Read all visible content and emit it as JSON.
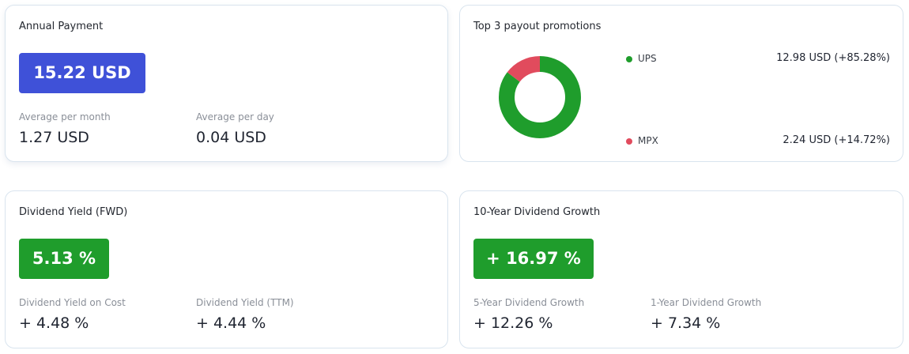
{
  "annual_payment": {
    "title": "Annual Payment",
    "value": "15.22 USD",
    "avg_month_label": "Average per month",
    "avg_month_value": "1.27 USD",
    "avg_day_label": "Average per day",
    "avg_day_value": "0.04 USD"
  },
  "promotions": {
    "title": "Top 3 payout promotions",
    "items": [
      {
        "name": "UPS",
        "value": "12.98 USD (+85.28%)",
        "share": 85.28,
        "color": "#1f9d2c"
      },
      {
        "name": "MPX",
        "value": "2.24 USD (+14.72%)",
        "share": 14.72,
        "color": "#e14b5d"
      }
    ]
  },
  "dividend_yield": {
    "title": "Dividend Yield (FWD)",
    "value": "5.13 %",
    "yoc_label": "Dividend Yield on Cost",
    "yoc_value": "+ 4.48 %",
    "ttm_label": "Dividend Yield (TTM)",
    "ttm_value": "+ 4.44 %"
  },
  "growth": {
    "title": "10-Year Dividend Growth",
    "value": "+ 16.97 %",
    "five_label": "5-Year Dividend Growth",
    "five_value": "+ 12.26 %",
    "one_label": "1-Year Dividend Growth",
    "one_value": "+ 7.34 %"
  },
  "colors": {
    "blue_pill": "#3f51d8",
    "green_pill": "#1f9d2c"
  }
}
